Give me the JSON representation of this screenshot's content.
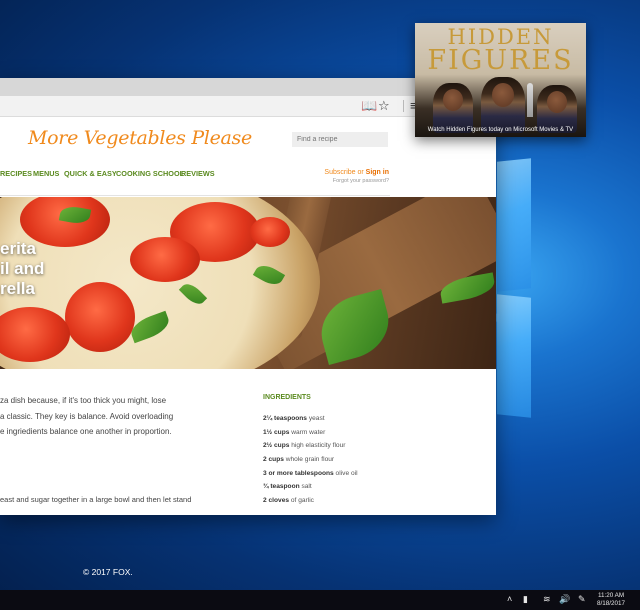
{
  "browser": {
    "toolbar": {
      "reading_icon": "reading-view-icon",
      "favorite_icon": "star-icon",
      "menu_icon": "menu-icon"
    }
  },
  "site": {
    "logo": "More Vegetables Please",
    "search_placeholder": "Find a recipe",
    "nav": [
      "RECIPES",
      "MENUS",
      "QUICK & EASY",
      "COOKING SCHOOL",
      "REVIEWS"
    ],
    "subscribe_prefix": "Subscribe or ",
    "sign_in": "Sign in",
    "forgot": "Forgot your password?",
    "accent_color": "#f08a1d",
    "nav_color": "#5a8a1f"
  },
  "hero": {
    "title_lines": [
      "erita",
      "il and",
      "rella"
    ]
  },
  "article": {
    "intro_lines": [
      "za dish because, if it's too thick you might, lose",
      "a classic. They key is balance. Avoid overloading",
      "e ingriedients balance one another in proportion."
    ],
    "step": "east and sugar together in a large bowl and then let stand",
    "ingredients_title": "INGREDIENTS",
    "ingredients": [
      {
        "qty": "2¼ teaspoons",
        "item": " yeast"
      },
      {
        "qty": "1½ cups",
        "item": " warm water"
      },
      {
        "qty": "2½ cups",
        "item": " high elasticity flour"
      },
      {
        "qty": "2 cups",
        "item": " whole grain flour"
      },
      {
        "qty": "3 or more tablespoons",
        "item": " olive oil"
      },
      {
        "qty": "¾ teaspoon",
        "item": " salt"
      },
      {
        "qty": "2 cloves",
        "item": " of garlic"
      }
    ]
  },
  "video_tile": {
    "title_line1": "HIDDEN",
    "title_line2": "FIGURES",
    "caption": "Watch Hidden Figures today on Microsoft Movies & TV"
  },
  "desktop": {
    "copyright": "© 2017 FOX."
  },
  "taskbar": {
    "time": "11:20 AM",
    "date": "8/18/2017"
  }
}
